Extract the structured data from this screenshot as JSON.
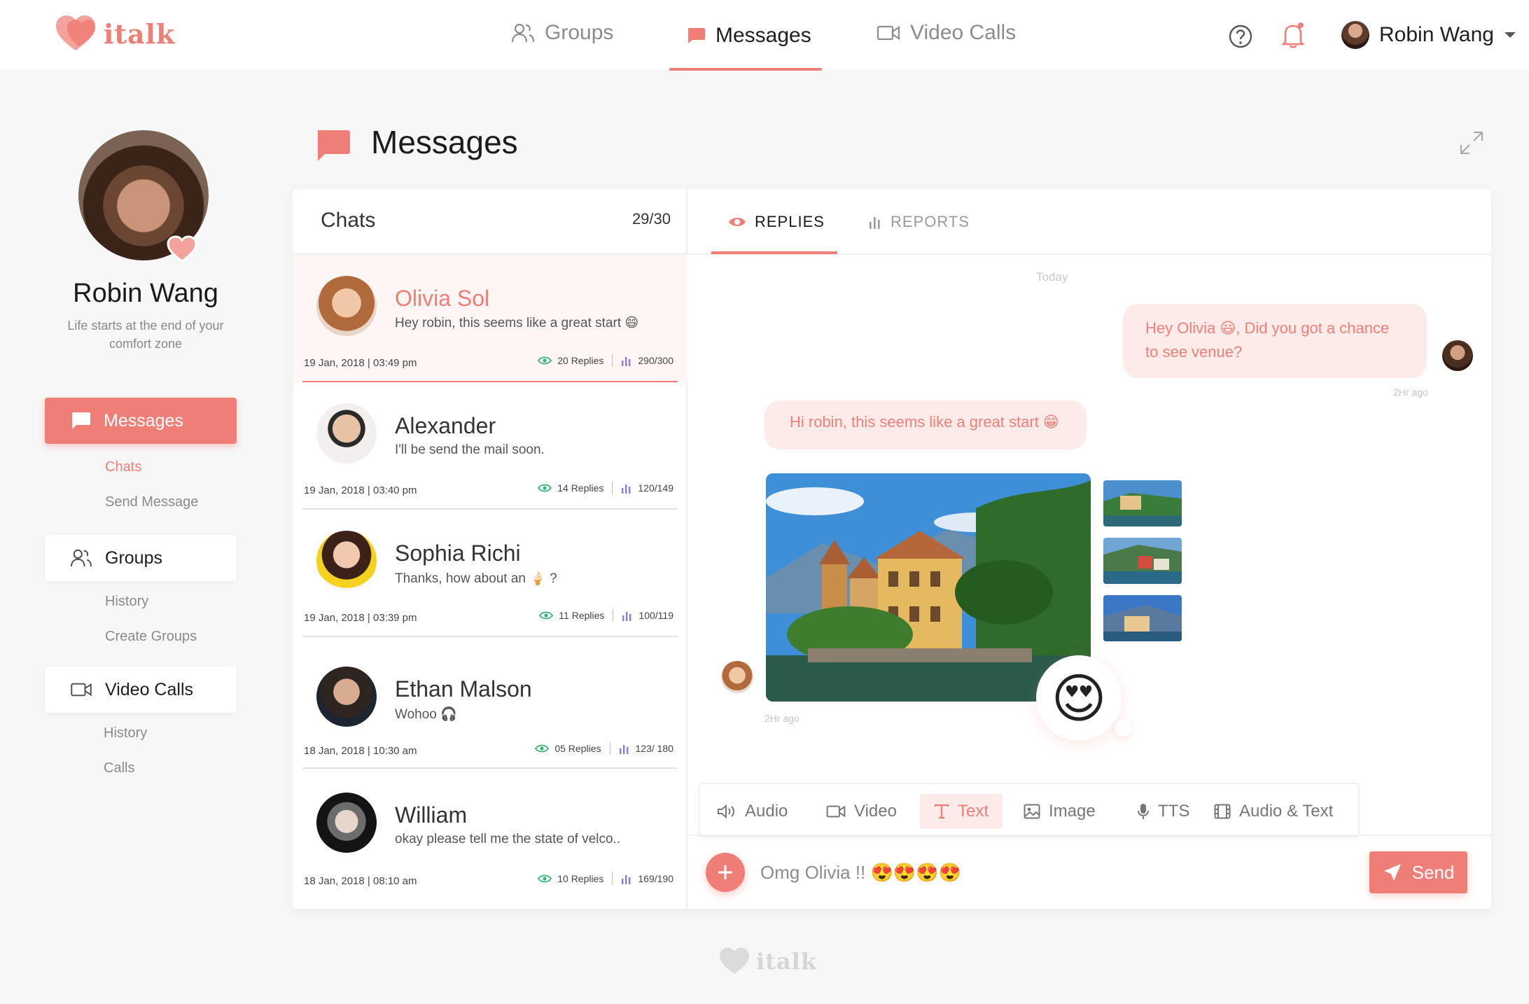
{
  "brand": {
    "name": "italk",
    "accent": "#ef7f76"
  },
  "topnav": {
    "items": [
      {
        "label": "Groups",
        "icon": "users-icon"
      },
      {
        "label": "Messages",
        "icon": "message-icon"
      },
      {
        "label": "Video Calls",
        "icon": "video-icon"
      }
    ],
    "active": "Messages",
    "user_name": "Robin Wang"
  },
  "profile": {
    "name": "Robin Wang",
    "bio": "Life starts at the end of your comfort zone"
  },
  "sidebar": {
    "messages": {
      "label": "Messages",
      "subs": [
        "Chats",
        "Send Message"
      ]
    },
    "groups": {
      "label": "Groups",
      "subs": [
        "History",
        "Create Groups"
      ]
    },
    "video_calls": {
      "label": "Video Calls",
      "subs": [
        "History",
        "Calls"
      ]
    }
  },
  "page": {
    "title": "Messages"
  },
  "chats": {
    "title": "Chats",
    "count": "29/30",
    "items": [
      {
        "name": "Olivia Sol",
        "message": "Hey robin, this seems like a great start 😄",
        "date": "19 Jan, 2018  |  03:49 pm",
        "replies": "20 Replies",
        "ratio": "290/300"
      },
      {
        "name": "Alexander",
        "message": "I'll be send the mail soon.",
        "date": "19 Jan, 2018 | 03:40 pm",
        "replies": "14 Replies",
        "ratio": "120/149"
      },
      {
        "name": "Sophia Richi",
        "message": "Thanks, how about an 🍦 ?",
        "date": "19 Jan, 2018 | 03:39 pm",
        "replies": "11 Replies",
        "ratio": "100/119"
      },
      {
        "name": "Ethan Malson",
        "message": "Wohoo 🎧",
        "date": "18 Jan, 2018 | 10:30 am",
        "replies": "05 Replies",
        "ratio": "123/ 180"
      },
      {
        "name": "William",
        "message": "okay please tell me the state of velco..",
        "date": "18 Jan, 2018 | 08:10 am",
        "replies": "10 Replies",
        "ratio": "169/190"
      }
    ]
  },
  "tabs": {
    "replies": "REPLIES",
    "reports": "REPORTS"
  },
  "conversation": {
    "day": "Today",
    "outgoing": "Hey Olivia 😃, Did you got a chance to see venue?",
    "outgoing_time": "2Hr ago",
    "incoming": "Hi robin, this seems like a great start 😁",
    "incoming_time": "2Hr ago",
    "reaction": "😍"
  },
  "composer": {
    "tools": [
      "Audio",
      "Video",
      "Text",
      "Image",
      "TTS",
      "Audio & Text"
    ],
    "active_tool": "Text",
    "input_value": "Omg Olivia !! 😍😍😍😍",
    "send_label": "Send"
  }
}
